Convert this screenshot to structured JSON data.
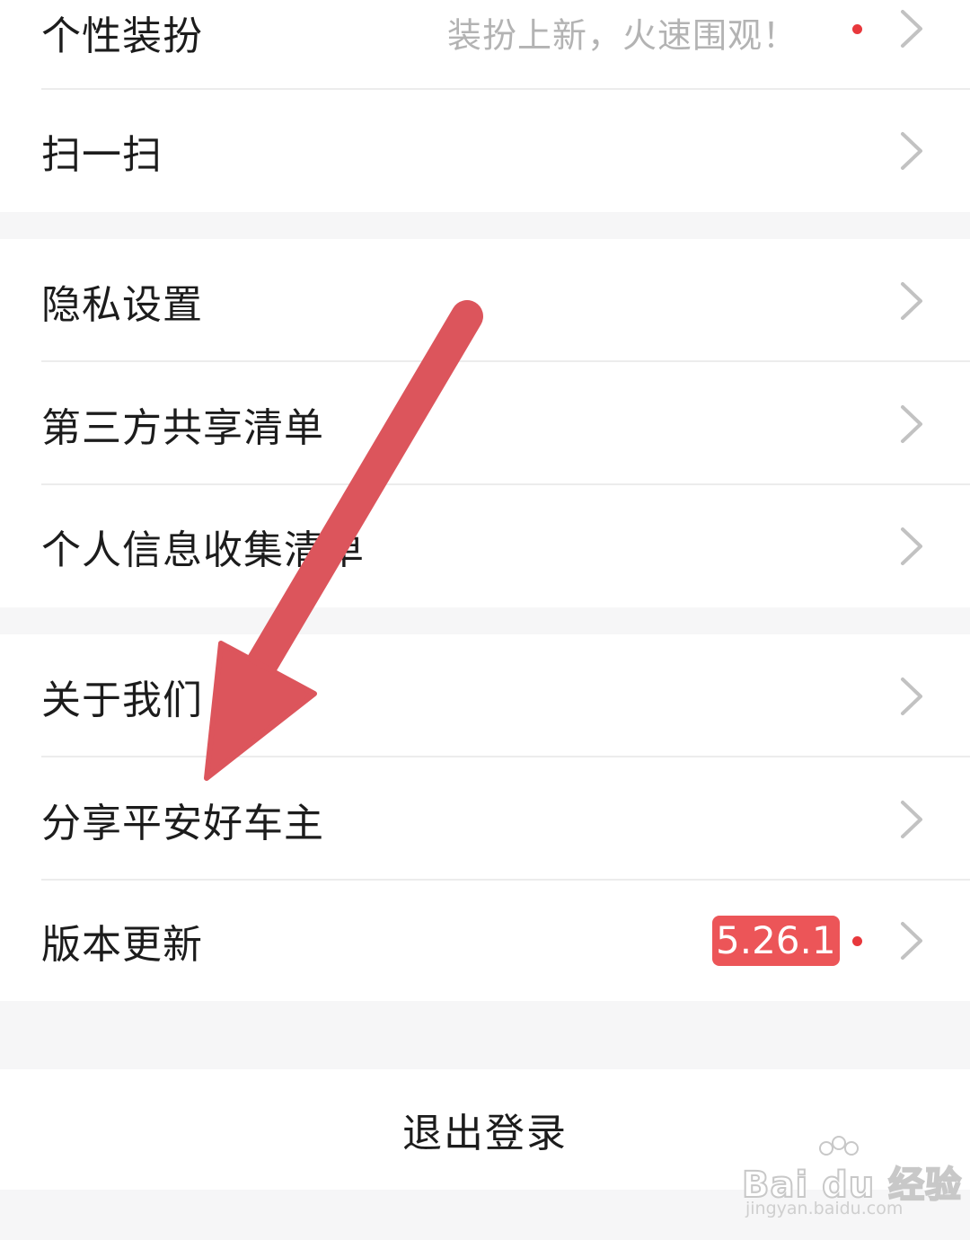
{
  "group1": {
    "items": [
      {
        "label": "个性装扮",
        "subtitle": "装扮上新，火速围观！",
        "has_dot": true
      },
      {
        "label": "扫一扫"
      }
    ]
  },
  "group2": {
    "items": [
      {
        "label": "隐私设置"
      },
      {
        "label": "第三方共享清单"
      },
      {
        "label": "个人信息收集清单"
      }
    ]
  },
  "group3": {
    "items": [
      {
        "label": "关于我们"
      },
      {
        "label": "分享平安好车主"
      },
      {
        "label": "版本更新",
        "badge": "5.26.1",
        "has_dot": true
      }
    ]
  },
  "logout": {
    "label": "退出登录"
  },
  "watermark": {
    "brand": "Bai du 经验",
    "url": "jingyan.baidu.com"
  },
  "colors": {
    "dot": "#e8383c",
    "badge_bg": "#ec5558",
    "arrow": "#dc555c",
    "chevron": "#c2c2c2"
  },
  "icons": {
    "chevron": "chevron-right-icon",
    "arrow": "annotation-arrow-icon",
    "watermark": "paw-icon"
  }
}
